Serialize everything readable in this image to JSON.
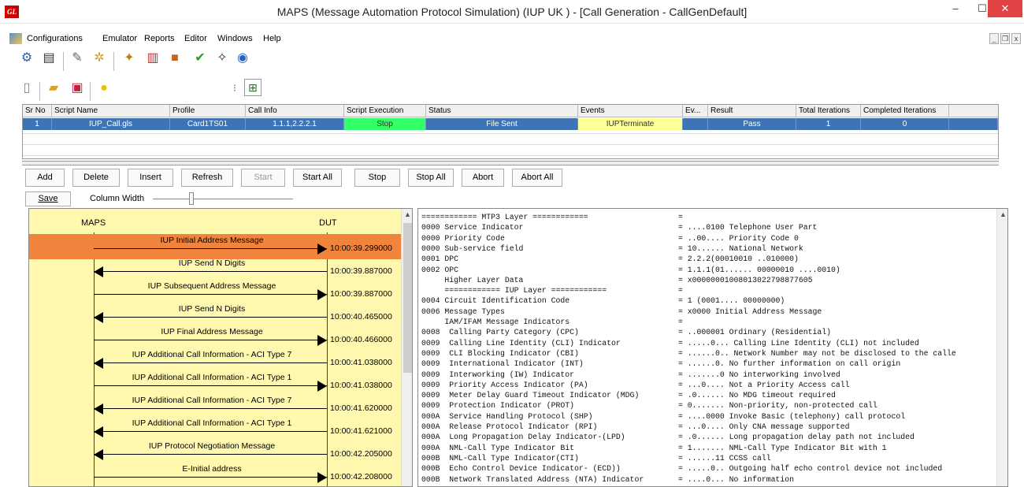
{
  "window": {
    "logo": "GL",
    "title": "MAPS (Message Automation Protocol Simulation)  (IUP UK ) - [Call Generation - CallGenDefault]",
    "minimize": "–",
    "maximize": "☐",
    "close": "✕"
  },
  "menu": [
    "Configurations",
    "Emulator",
    "Reports",
    "Editor",
    "Windows",
    "Help"
  ],
  "mdi": [
    "_",
    "❐",
    "x"
  ],
  "toolbar1_icons": [
    "gear-icon",
    "notepad-icon",
    "pencil-icon",
    "cogs-icon",
    "wrench-icon",
    "books-icon",
    "briefcase-icon",
    "checkmark-icon",
    "magic-wand-icon",
    "help-icon"
  ],
  "toolbar2_icons": [
    "new-file-icon",
    "open-folder-icon",
    "save-icon",
    "bulb-icon",
    "traffic-light-icon",
    "network-icon"
  ],
  "grid": {
    "columns": [
      "Sr No",
      "Script Name",
      "Profile",
      "Call Info",
      "Script Execution",
      "Status",
      "Events",
      "Ev...",
      "Result",
      "Total Iterations",
      "Completed Iterations"
    ],
    "row": [
      "1",
      "IUP_Call.gls",
      "Card1TS01",
      "1.1.1,2.2.2.1",
      "Stop",
      "File Sent",
      "IUPTerminate",
      "",
      "Pass",
      "1",
      "0"
    ],
    "colors": {
      "stop": "#33ff66",
      "events": "#ffff99",
      "row": "#3e74b5"
    }
  },
  "buttons": [
    "Add",
    "Delete",
    "Insert",
    "Refresh",
    "Start",
    "Start All",
    "Stop",
    "Stop All",
    "Abort",
    "Abort All"
  ],
  "save_label": "Save",
  "column_width_label": "Column Width",
  "ladder": {
    "left_label": "MAPS",
    "right_label": "DUT",
    "messages": [
      {
        "label": "IUP Initial Address Message",
        "time": "10:00:39.299000",
        "dir": "right",
        "selected": true
      },
      {
        "label": "IUP Send N Digits",
        "time": "10:00:39.887000",
        "dir": "left",
        "selected": false
      },
      {
        "label": "IUP Subsequent Address Message",
        "time": "10:00:39.887000",
        "dir": "right",
        "selected": false
      },
      {
        "label": "IUP Send N Digits",
        "time": "10:00:40.465000",
        "dir": "left",
        "selected": false
      },
      {
        "label": "IUP Final Address Message",
        "time": "10:00:40.466000",
        "dir": "right",
        "selected": false
      },
      {
        "label": "IUP Additional Call Information - ACI Type 7",
        "time": "10:00:41.038000",
        "dir": "left",
        "selected": false
      },
      {
        "label": "IUP Additional Call Information - ACI Type 1",
        "time": "10:00:41.038000",
        "dir": "right",
        "selected": false
      },
      {
        "label": "IUP Additional Call Information - ACI Type 7",
        "time": "10:00:41.620000",
        "dir": "left",
        "selected": false
      },
      {
        "label": "IUP Additional Call Information - ACI Type 1",
        "time": "10:00:41.621000",
        "dir": "left",
        "selected": false
      },
      {
        "label": "IUP Protocol Negotiation Message",
        "time": "10:00:42.205000",
        "dir": "left",
        "selected": false
      },
      {
        "label": "E-Initial address",
        "time": "10:00:42.208000",
        "dir": "right",
        "selected": false
      }
    ]
  },
  "detail_lines": [
    [
      "============ MTP3 Layer ============",
      "="
    ],
    [
      "0000 Service Indicator",
      "= ....0100 Telephone User Part"
    ],
    [
      "0000 Priority Code",
      "= ..00.... Priority Code 0"
    ],
    [
      "0000 Sub-service field",
      "= 10...... National Network"
    ],
    [
      "0001 DPC",
      "= 2.2.2(00010010 ..010000)"
    ],
    [
      "0002 OPC",
      "= 1.1.1(01...... 00000010 ....0010)"
    ],
    [
      "     Higher Layer Data",
      "= x00000001008013022798877605"
    ],
    [
      "     ============ IUP Layer ============",
      "="
    ],
    [
      "0004 Circuit Identification Code",
      "= 1 (0001.... 00000000)"
    ],
    [
      "0006 Message Types",
      "= x0000 Initial Address Message"
    ],
    [
      "     IAM/IFAM Message Indicators",
      "="
    ],
    [
      "0008  Calling Party Category (CPC)",
      "= ..000001 Ordinary (Residential)"
    ],
    [
      "0009  Calling Line Identity (CLI) Indicator",
      "= .....0... Calling Line Identity (CLI) not included"
    ],
    [
      "0009  CLI Blocking Indicator (CBI)",
      "= ......0.. Network Number may not be disclosed to the calle"
    ],
    [
      "0009  International Indicator (INT)",
      "= ......0. No further information on call origin"
    ],
    [
      "0009  Interworking (IW) Indicator",
      "= .......0 No interworking involved"
    ],
    [
      "0009  Priority Access Indicator (PA)",
      "= ...0.... Not a Priority Access call"
    ],
    [
      "0009  Meter Delay Guard Timeout Indicator (MDG)",
      "= .0...... No MDG timeout required"
    ],
    [
      "0009  Protection Indicator (PROT)",
      "= 0....... Non-priority, non-protected call"
    ],
    [
      "000A  Service Handling Protocol (SHP)",
      "= ....0000 Invoke Basic (telephony) call protocol"
    ],
    [
      "000A  Release Protocol Indicator (RPI)",
      "= ...0.... Only CNA message supported"
    ],
    [
      "000A  Long Propagation Delay Indicator-(LPD)",
      "= .0...... Long propagation delay path not included"
    ],
    [
      "000A  NML-Call Type Indicator Bit",
      "= 1....... NML-Call Type Indicator Bit with 1"
    ],
    [
      "000B  NML-Call Type Indicator(CTI)",
      "= ......11 CCSS call"
    ],
    [
      "000B  Echo Control Device Indicator- (ECD))",
      "= .....0.. Outgoing half echo control device not included"
    ],
    [
      "000B  Network Translated Address (NTA) Indicator",
      "= ....0... No information"
    ]
  ]
}
